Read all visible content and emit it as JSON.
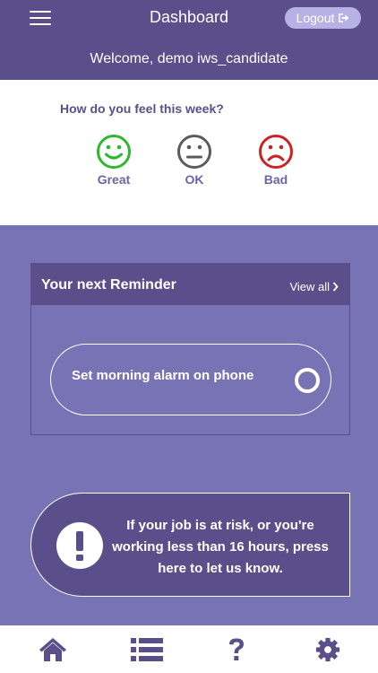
{
  "header": {
    "title": "Dashboard",
    "logout_label": "Logout",
    "welcome": "Welcome, demo iws_candidate"
  },
  "mood": {
    "question": "How do you feel this week?",
    "options": [
      {
        "label": "Great",
        "color": "#2eb82e"
      },
      {
        "label": "OK",
        "color": "#5b5b5b"
      },
      {
        "label": "Bad",
        "color": "#cc2222"
      }
    ]
  },
  "reminder": {
    "title": "Your next Reminder",
    "view_all": "View all",
    "task": "Set morning alarm on phone"
  },
  "risk": {
    "message": "If your job is at risk, or you're working less than 16 hours, press here to let us know."
  },
  "footer": {
    "items": [
      "home-icon",
      "list-icon",
      "help-icon",
      "settings-icon"
    ]
  },
  "colors": {
    "primary": "#5a4f8a",
    "background": "#7873b5",
    "logout_button": "#b7b1e6"
  }
}
